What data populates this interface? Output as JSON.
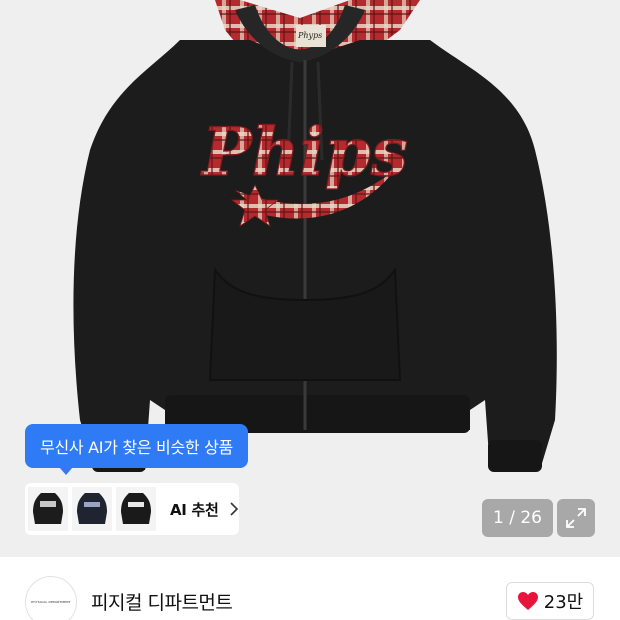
{
  "product_image": {
    "alt_icon": "hoodie-product-photo",
    "logo_text": "Phips",
    "hood_tag_text": "Phyps",
    "colors": {
      "hoodie": "#1c1c1c",
      "plaid_red": "#b52a2e",
      "plaid_cream": "#e8d9c6",
      "background": "#efefef"
    }
  },
  "ai_tooltip": {
    "label": "무신사 AI가 찾은 비슷한 상품",
    "color": "#2f7bf6"
  },
  "ai_recommend": {
    "label": "AI 추천",
    "thumbnails": [
      "thumb-hoodie-1",
      "thumb-hoodie-2",
      "thumb-hoodie-3"
    ]
  },
  "gallery": {
    "counter": "1 / 26",
    "expand_icon": "expand-icon"
  },
  "brand": {
    "name": "피지컬 디파트먼트",
    "logo_text": "PHYSICAL DEPARTMENT"
  },
  "like": {
    "count": "23만",
    "icon": "heart-icon",
    "color": "#e8143b"
  }
}
